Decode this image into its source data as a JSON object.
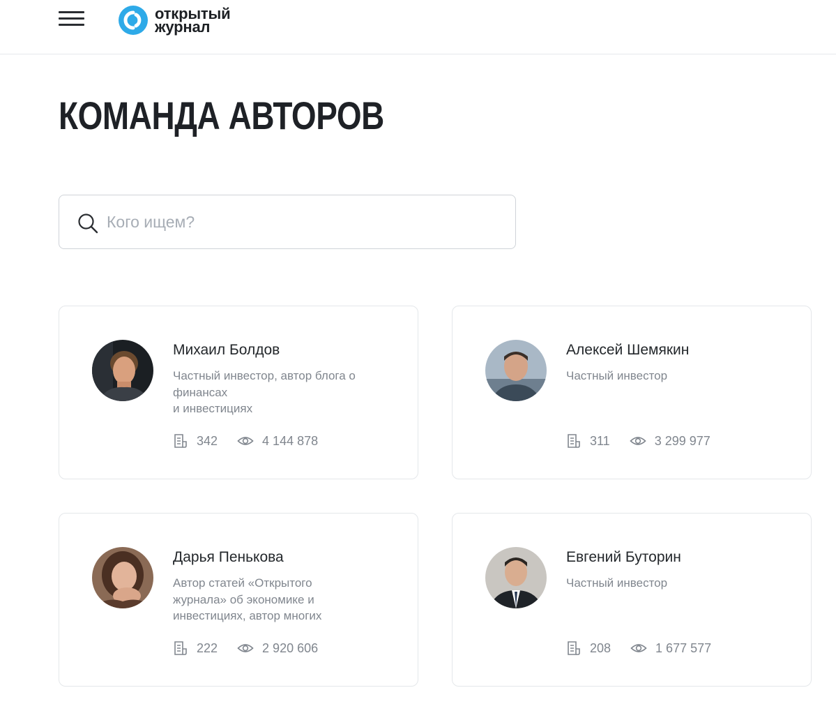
{
  "header": {
    "logo_line1": "открытый",
    "logo_line2": "журнал",
    "logo_color": "#2eaae8"
  },
  "page": {
    "title": "КОМАНДА АВТОРОВ"
  },
  "search": {
    "placeholder": "Кого ищем?",
    "value": ""
  },
  "authors": [
    {
      "name": "Михаил Болдов",
      "desc_lines": [
        "Частный инвестор, автор блога о",
        "финансах",
        "и инвестициях"
      ],
      "articles": "342",
      "views": "4 144 878"
    },
    {
      "name": "Алексей Шемякин",
      "desc_lines": [
        "Частный инвестор"
      ],
      "articles": "311",
      "views": "3 299 977"
    },
    {
      "name": "Дарья Пенькова",
      "desc_lines": [
        "Автор статей «Открытого",
        "журнала» об экономике и",
        "инвестициях, автор многих"
      ],
      "articles": "222",
      "views": "2 920 606"
    },
    {
      "name": "Евгений Буторин",
      "desc_lines": [
        "Частный инвестор"
      ],
      "articles": "208",
      "views": "1 677 577"
    }
  ],
  "icons": {
    "menu": "hamburger-menu-icon",
    "search": "search-icon",
    "articles": "document-icon",
    "views": "eye-icon"
  }
}
